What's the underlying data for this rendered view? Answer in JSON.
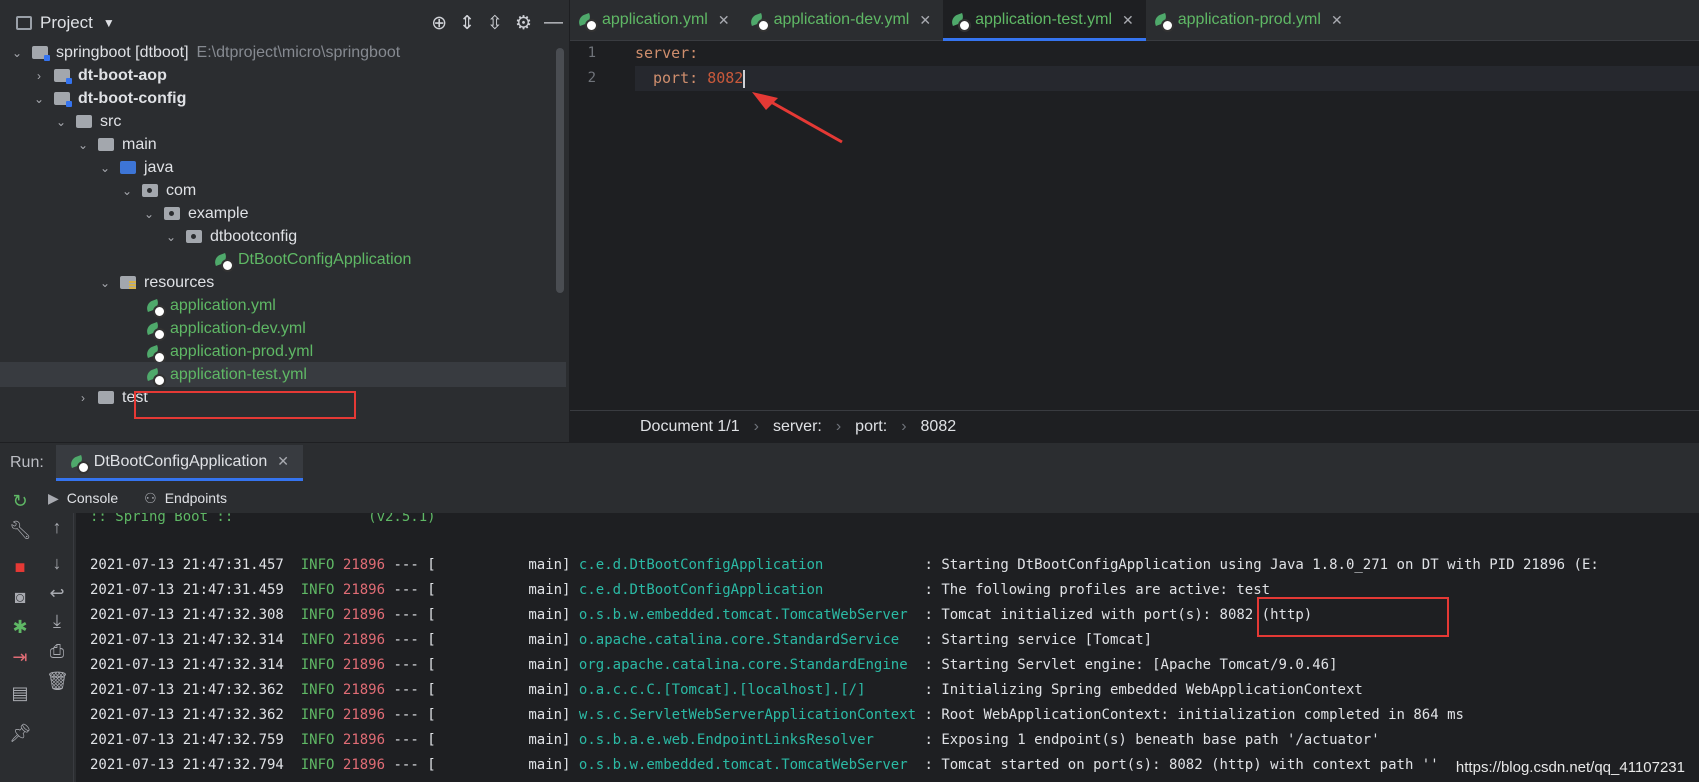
{
  "project_panel": {
    "title": "Project",
    "tree": [
      {
        "label": "springboot [dtboot]",
        "path": "E:\\dtproject\\micro\\springboot",
        "expanded": true
      },
      {
        "label": "dt-boot-aop",
        "expanded": false
      },
      {
        "label": "dt-boot-config",
        "expanded": true
      },
      {
        "label": "src",
        "expanded": true
      },
      {
        "label": "main",
        "expanded": true
      },
      {
        "label": "java",
        "expanded": true
      },
      {
        "label": "com",
        "expanded": true
      },
      {
        "label": "example",
        "expanded": true
      },
      {
        "label": "dtbootconfig",
        "expanded": true
      },
      {
        "label": "DtBootConfigApplication"
      },
      {
        "label": "resources",
        "expanded": true
      },
      {
        "label": "application.yml"
      },
      {
        "label": "application-dev.yml"
      },
      {
        "label": "application-prod.yml"
      },
      {
        "label": "application-test.yml",
        "selected": true
      },
      {
        "label": "test",
        "expanded": false
      }
    ]
  },
  "editor": {
    "tabs": [
      {
        "label": "application.yml",
        "active": false
      },
      {
        "label": "application-dev.yml",
        "active": false
      },
      {
        "label": "application-test.yml",
        "active": true
      },
      {
        "label": "application-prod.yml",
        "active": false
      }
    ],
    "lines": [
      {
        "num": "1",
        "key": "server:",
        "value": ""
      },
      {
        "num": "2",
        "key": "port:",
        "value": "8082"
      }
    ],
    "breadcrumb": [
      "Document 1/1",
      "server:",
      "port:",
      "8082"
    ]
  },
  "run_panel": {
    "label": "Run:",
    "tab": "DtBootConfigApplication",
    "subtabs": [
      "Console",
      "Endpoints"
    ],
    "banner": ":: Spring Boot ::                (v2.5.1)",
    "logs": [
      {
        "ts": "2021-07-13 21:47:31.457",
        "level": "INFO",
        "pid": "21896",
        "thread": "main",
        "logger": "c.e.d.DtBootConfigApplication",
        "msg": "Starting DtBootConfigApplication using Java 1.8.0_271 on DT with PID 21896 (E:"
      },
      {
        "ts": "2021-07-13 21:47:31.459",
        "level": "INFO",
        "pid": "21896",
        "thread": "main",
        "logger": "c.e.d.DtBootConfigApplication",
        "msg": "The following profiles are active: test"
      },
      {
        "ts": "2021-07-13 21:47:32.308",
        "level": "INFO",
        "pid": "21896",
        "thread": "main",
        "logger": "o.s.b.w.embedded.tomcat.TomcatWebServer",
        "msg": "Tomcat initialized with port(s): 8082 (http)"
      },
      {
        "ts": "2021-07-13 21:47:32.314",
        "level": "INFO",
        "pid": "21896",
        "thread": "main",
        "logger": "o.apache.catalina.core.StandardService",
        "msg": "Starting service [Tomcat]"
      },
      {
        "ts": "2021-07-13 21:47:32.314",
        "level": "INFO",
        "pid": "21896",
        "thread": "main",
        "logger": "org.apache.catalina.core.StandardEngine",
        "msg": "Starting Servlet engine: [Apache Tomcat/9.0.46]"
      },
      {
        "ts": "2021-07-13 21:47:32.362",
        "level": "INFO",
        "pid": "21896",
        "thread": "main",
        "logger": "o.a.c.c.C.[Tomcat].[localhost].[/]",
        "msg": "Initializing Spring embedded WebApplicationContext"
      },
      {
        "ts": "2021-07-13 21:47:32.362",
        "level": "INFO",
        "pid": "21896",
        "thread": "main",
        "logger": "w.s.c.ServletWebServerApplicationContext",
        "msg": "Root WebApplicationContext: initialization completed in 864 ms"
      },
      {
        "ts": "2021-07-13 21:47:32.759",
        "level": "INFO",
        "pid": "21896",
        "thread": "main",
        "logger": "o.s.b.a.e.web.EndpointLinksResolver",
        "msg": "Exposing 1 endpoint(s) beneath base path '/actuator'"
      },
      {
        "ts": "2021-07-13 21:47:32.794",
        "level": "INFO",
        "pid": "21896",
        "thread": "main",
        "logger": "o.s.b.w.embedded.tomcat.TomcatWebServer",
        "msg": "Tomcat started on port(s): 8082 (http) with context path ''"
      }
    ],
    "watermark": "https://blog.csdn.net/qq_41107231"
  },
  "colors": {
    "accent": "#3574f0",
    "annotation_red": "#e53935",
    "yaml_file_green": "#5fb865"
  }
}
